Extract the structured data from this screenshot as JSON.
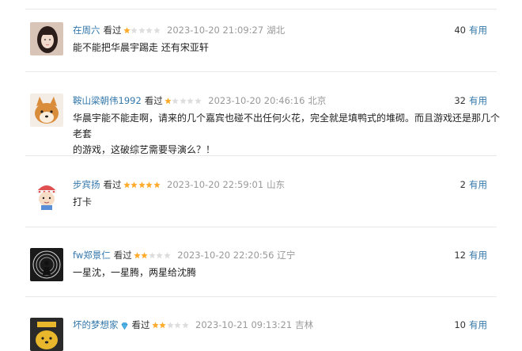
{
  "colors": {
    "link": "#3377aa",
    "star_on": "#ffac2d",
    "star_off": "#dddddd",
    "meta": "#999999",
    "separator": "#e8e8e8"
  },
  "comments": [
    {
      "user": "在周六",
      "status": "看过",
      "rating": 1,
      "time": "2023-10-20 21:09:27",
      "location": "湖北",
      "useful_count": "40",
      "useful_label": "有用",
      "text": "能不能把华晨宇踢走 还有宋亚轩",
      "avatar": "girl-portrait-avatar"
    },
    {
      "user": "鞍山梁朝伟1992",
      "status": "看过",
      "rating": 1,
      "time": "2023-10-20 20:46:16",
      "location": "北京",
      "useful_count": "32",
      "useful_label": "有用",
      "text_lines": [
        "华晨宇能不能走啊，请来的几个嘉宾也碰不出任何火花，完全就是填鸭式的堆砌。而且游戏还是那几个老套",
        "的游戏，这破综艺需要导演么？！"
      ],
      "avatar": "shiba-dog-avatar"
    },
    {
      "user": "步宾扬",
      "status": "看过",
      "rating": 5,
      "time": "2023-10-20 22:59:01",
      "location": "山东",
      "useful_count": "2",
      "useful_label": "有用",
      "text": "打卡",
      "avatar": "cartoon-character-avatar"
    },
    {
      "user": "fw郑景仁",
      "status": "看过",
      "rating": 2,
      "time": "2023-10-20 22:20:56",
      "location": "辽宁",
      "useful_count": "12",
      "useful_label": "有用",
      "text": "一星沈，一星腾，两星给沈腾",
      "avatar": "silhouette-spiral-avatar"
    },
    {
      "user": "坏的梦想家",
      "status": "看过",
      "rating": 2,
      "time": "2023-10-21 09:13:21",
      "location": "吉林",
      "useful_count": "10",
      "useful_label": "有用",
      "text": "",
      "avatar": "yellow-dog-avatar",
      "has_badge": true
    }
  ]
}
